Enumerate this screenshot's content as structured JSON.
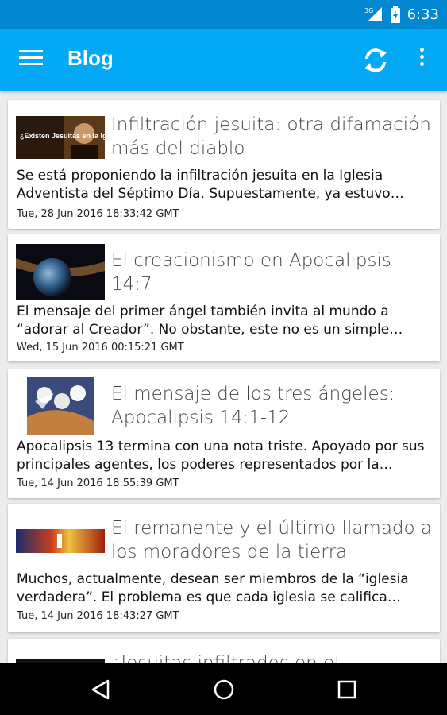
{
  "status_bar": {
    "network": "3G",
    "time": "6:33"
  },
  "app_bar": {
    "title": "Blog",
    "menu_icon": "hamburger-menu-icon",
    "refresh_icon": "refresh-icon",
    "more_icon": "more-vert-icon"
  },
  "posts": [
    {
      "title": "Infiltración jesuita: otra difamación más del diablo",
      "excerpt": "Se está proponiendo la infiltración jesuita en la Iglesia Adventista del Séptimo Día. Supuestamente, ya estuvo…",
      "date": "Tue, 28 Jun 2016 18:33:42 GMT",
      "thumb_caption": "¿Existen Jesuitas en la Iglesia?"
    },
    {
      "title": "El creacionismo en Apocalipsis 14:7",
      "excerpt": "El mensaje del primer ángel también invita al mundo a “adorar al Creador”. No obstante, este no es un simple…",
      "date": "Wed, 15 Jun 2016 00:15:21 GMT"
    },
    {
      "title": "El mensaje de los tres ángeles: Apocalipsis 14:1-12",
      "excerpt": "Apocalipsis 13 termina con una nota triste. Apoyado por sus principales agentes, los poderes representados por la…",
      "date": "Tue, 14 Jun 2016 18:55:39 GMT"
    },
    {
      "title": "El remanente y el último llamado a los moradores de la tierra",
      "excerpt": "Muchos, actualmente, desean ser miembros de la “iglesia verdadera”. El problema es que cada iglesia se califica…",
      "date": "Tue, 14 Jun 2016 18:43:27 GMT"
    },
    {
      "title": "¿Jesuitas infiltrados en el"
    }
  ],
  "nav": {
    "back_icon": "back-icon",
    "home_icon": "home-icon",
    "recents_icon": "recents-icon"
  }
}
